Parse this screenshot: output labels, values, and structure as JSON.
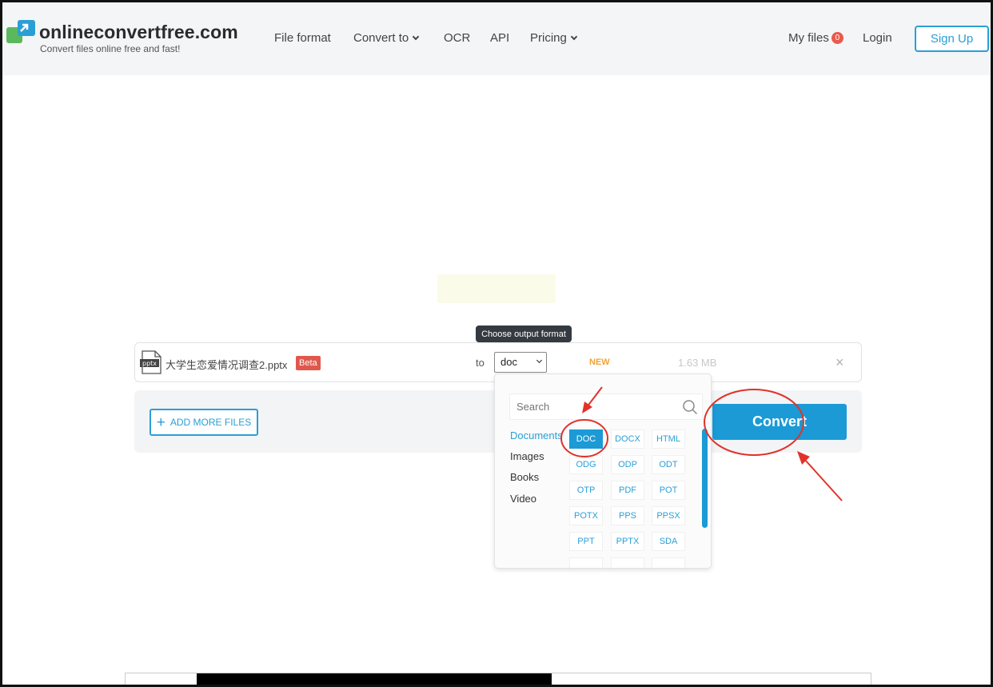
{
  "header": {
    "logo_title": "onlineconvertfree.com",
    "logo_tagline": "Convert files online free and fast!",
    "nav": {
      "file_format": "File format",
      "convert_to": "Convert to",
      "ocr": "OCR",
      "api": "API",
      "pricing": "Pricing"
    },
    "my_files": "My files",
    "my_files_count": "0",
    "login": "Login",
    "signup": "Sign Up"
  },
  "tooltip": "Choose output format",
  "file": {
    "icon_label": "pptx",
    "name": "大学生恋爱情况调查2.pptx",
    "beta": "Beta",
    "to_label": "to",
    "selected_format": "doc",
    "status": "NEW",
    "size": "1.63 MB",
    "remove": "×"
  },
  "actions": {
    "add_more": "ADD MORE FILES",
    "convert": "Convert"
  },
  "dropdown": {
    "search_placeholder": "Search",
    "categories": [
      "Documents",
      "Images",
      "Books",
      "Video"
    ],
    "active_category": "Documents",
    "formats": [
      [
        "DOC",
        "DOCX",
        "HTML"
      ],
      [
        "ODG",
        "ODP",
        "ODT"
      ],
      [
        "OTP",
        "PDF",
        "POT"
      ],
      [
        "POTX",
        "PPS",
        "PPSX"
      ],
      [
        "PPT",
        "PPTX",
        "SDA"
      ]
    ],
    "selected_format": "DOC"
  },
  "colors": {
    "accent": "#1b9ad6",
    "badge": "#e85a4f",
    "status_new": "#f0a33a",
    "annotation": "#e0322a"
  }
}
